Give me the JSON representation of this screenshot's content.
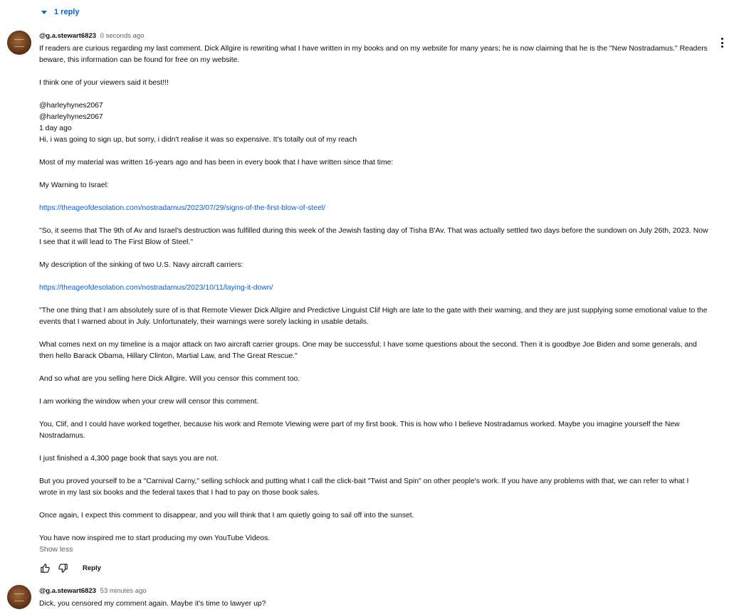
{
  "replies_toggle": {
    "label": "1 reply"
  },
  "comment1": {
    "author": "@g.a.stewart6823",
    "time": "0 seconds ago",
    "paragraphs": [
      "If readers are curious regarding my last comment. Dick Allgire is rewriting what I have written in my books and on my website for many years; he is now claiming that he is the \"New Nostradamus.\" Readers beware, this information can be found for free on my website.",
      "",
      "I think one of your viewers said it best!!!",
      "",
      "@harleyhynes2067",
      "@harleyhynes2067",
      "1 day ago",
      "Hi, i was going to sign up, but sorry, i didn't realise it was so expensive. It's totally out of my reach",
      "",
      "Most of my material was written 16-years ago and has been in every book that I have written since that time:",
      "",
      "My Warning to Israel:",
      "",
      "https://theageofdesolation.com/nostradamus/2023/07/29/signs-of-the-first-blow-of-steel/",
      "",
      "\"So, it seems that The 9th of Av and Israel's destruction was fulfilled during this week of the Jewish fasting day of Tisha B'Av. That was actually settled two days before the sundown on July 26th, 2023. Now I see that it will lead to The First Blow of Steel.\"",
      "",
      "My description of the sinking of two U.S. Navy aircraft carriers:",
      "",
      "https://theageofdesolation.com/nostradamus/2023/10/11/laying-it-down/",
      "",
      "\"The one thing that I am absolutely sure of is that Remote Viewer Dick Allgire and Predictive Linguist Clif High are late to the gate with their warning, and they are just supplying some emotional value to the events that I warned about in July. Unfortunately, their warnings were sorely lacking in usable details.",
      "",
      "What comes next on my timeline is a major attack on two aircraft carrier groups. One may be successful; I have some questions about the second. Then it is goodbye Joe Biden and some generals, and then hello Barack Obama, Hillary Clinton, Martial Law, and The Great Rescue.\"",
      "",
      "And so what are you selling here Dick Allgire. Will you censor this comment too.",
      "",
      "I am working the window when your crew will censor this comment.",
      "",
      "You, Clif, and I could have worked together, because his work and Remote Viewing were part of my first book. This is how who I believe Nostradamus worked. Maybe you imagine yourself the New Nostradamus.",
      "",
      "I just finished a 4,300 page book that says you are not.",
      "",
      "But you proved yourself to be a \"Carnival Carny,\" selling schlock and putting what I call the click-bait \"Twist and Spin\" on other people's work. If you have any problems with that, we can refer to what I wrote in my last six books and the federal taxes that I had to pay on those book sales.",
      "",
      "Once again, I expect this comment to disappear, and you will think that I am quietly going to sail off into the sunset.",
      "",
      "You have now inspired me to start producing my own YouTube Videos."
    ],
    "show_less": "Show less",
    "reply_label": "Reply"
  },
  "comment2": {
    "author": "@g.a.stewart6823",
    "time": "53 minutes ago",
    "text": "Dick, you censored my comment again. Maybe it's time to lawyer up?"
  }
}
